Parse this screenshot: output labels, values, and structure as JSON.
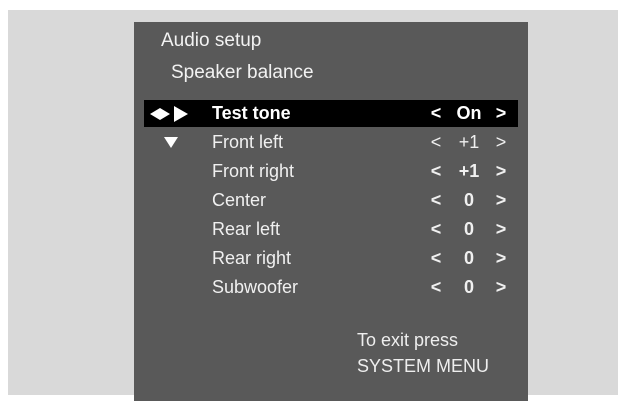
{
  "menu": {
    "title": "Audio setup",
    "subtitle": "Speaker balance",
    "items": [
      {
        "label": "Test tone",
        "left": "<",
        "value": "On",
        "right": ">"
      },
      {
        "label": "Front left",
        "left": "<",
        "value": "+1",
        "right": ">"
      },
      {
        "label": "Front right",
        "left": "<",
        "value": "+1",
        "right": ">"
      },
      {
        "label": "Center",
        "left": "<",
        "value": "0",
        "right": ">"
      },
      {
        "label": "Rear left",
        "left": "<",
        "value": "0",
        "right": ">"
      },
      {
        "label": "Rear right",
        "left": "<",
        "value": "0",
        "right": ">"
      },
      {
        "label": "Subwoofer",
        "left": "<",
        "value": "0",
        "right": ">"
      }
    ],
    "selected_index": 0,
    "icons": {
      "selected_row": "diamond-right-arrow-icon",
      "next_row": "down-arrow-icon"
    }
  },
  "footer": {
    "line1": "To exit press",
    "line2": "SYSTEM MENU"
  },
  "colors": {
    "panel": "#595959",
    "frame": "#d9d9d9",
    "highlight": "#000000",
    "text": "#f0f0f0"
  }
}
